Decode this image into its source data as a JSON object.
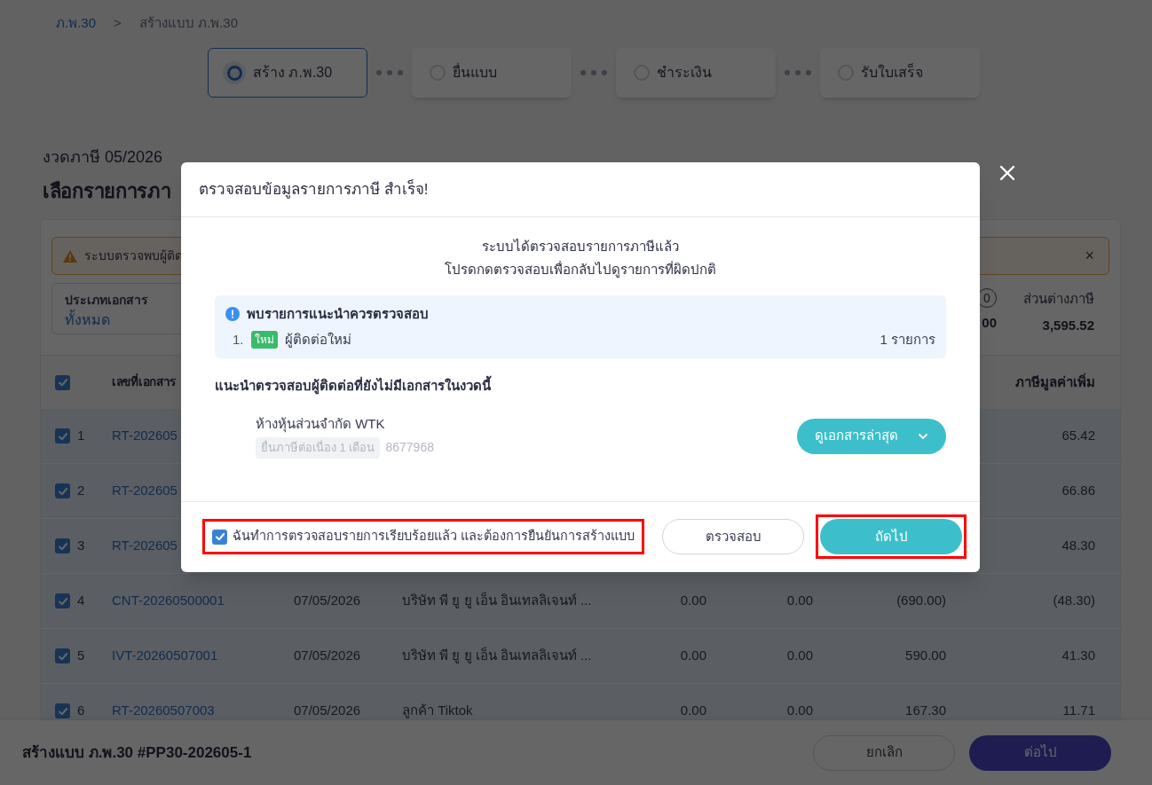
{
  "breadcrumb": [
    {
      "label": "ภ.พ.30",
      "kind": "link"
    },
    {
      "label": ">",
      "kind": "separator"
    },
    {
      "label": "สร้างแบบ ภ.พ.30",
      "kind": "current"
    }
  ],
  "steps": [
    {
      "label": "สร้าง ภ.พ.30",
      "selected": true
    },
    {
      "label": "ยื่นแบบ",
      "selected": false
    },
    {
      "label": "ชำระเงิน",
      "selected": false
    },
    {
      "label": "รับใบเสร็จ",
      "selected": false
    }
  ],
  "period": "งวดภาษี 05/2026",
  "page_title": "เลือกรายการภา",
  "alert": {
    "text": "ระบบตรวจพบผู้ติด",
    "close": "×"
  },
  "filter": {
    "label": "ประเภทเอกสาร",
    "value": "ทั้งหมด"
  },
  "summary_partial": {
    "badge": "0",
    "value": "00"
  },
  "tax_difference": {
    "label": "ส่วนต่างภาษี",
    "value": "3,595.52"
  },
  "table": {
    "header_checked": true,
    "headers": {
      "document_no": "เลขที่เอกสาร",
      "vat": "ภาษีมูลค่าเพิ่ม"
    },
    "rows": [
      {
        "checked": true,
        "index": "1",
        "document_no": "RT-202605",
        "vat": "65.42"
      },
      {
        "checked": true,
        "index": "2",
        "document_no": "RT-202605",
        "vat": "66.86"
      },
      {
        "checked": true,
        "index": "3",
        "document_no": "RT-202605",
        "vat": "48.30"
      },
      {
        "checked": true,
        "index": "4",
        "document_no": "CNT-20260500001",
        "date": "07/05/2026",
        "name": "บริษัท พี ยู ยู เอ็น อินเทลลิเจนท์ ...",
        "column_5": "0.00",
        "column_6": "0.00",
        "column_7": "(690.00)",
        "vat": "(48.30)"
      },
      {
        "checked": true,
        "index": "5",
        "document_no": "IVT-20260507001",
        "date": "07/05/2026",
        "name": "บริษัท พี ยู ยู เอ็น อินเทลลิเจนท์ ...",
        "column_5": "0.00",
        "column_6": "0.00",
        "column_7": "590.00",
        "vat": "41.30"
      },
      {
        "checked": true,
        "index": "6",
        "document_no": "RT-20260507003",
        "date": "07/05/2026",
        "name": "ลูกค้า Tiktok",
        "column_5": "0.00",
        "column_6": "0.00",
        "column_7": "167.30",
        "vat": "11.71"
      }
    ]
  },
  "footer": {
    "title": "สร้างแบบ ภ.พ.30 #PP30-202605-1",
    "buttons": [
      {
        "label": "ยกเลิก",
        "kind": "secondary"
      },
      {
        "label": "ต่อไป",
        "kind": "primary"
      }
    ]
  },
  "dialog": {
    "title": "ตรวจสอบข้อมูลรายการภาษี สำเร็จ!",
    "message": [
      "ระบบได้ตรวจสอบรายการภาษีแล้ว",
      "โปรดกดตรวจสอบเพื่อกลับไปดูรายการที่ผิดปกติ"
    ],
    "notice": {
      "title": "พบรายการแนะนำควรตรวจสอบ",
      "items": [
        {
          "number": "1.",
          "tag": "ใหม่",
          "label": "ผู้ติดต่อใหม่",
          "count": "1 รายการ"
        }
      ]
    },
    "section_title": "แนะนำตรวจสอบผู้ติดต่อที่ยังไม่มีเอกสารในงวดนี้",
    "contacts": [
      {
        "name": "ห้างหุ้นส่วนจำกัด WTK",
        "tag": "ยื่นภาษีต่อเนื่อง 1 เดือน",
        "code": "8677968",
        "action": "ดูเอกสารล่าสุด"
      }
    ],
    "confirm": {
      "label": "ฉันทำการตรวจสอบรายการเรียบร้อยแล้ว และต้องการยืนยันการสร้างแบบ",
      "checked": true,
      "highlighted": true
    },
    "buttons": [
      {
        "label": "ตรวจสอบ",
        "kind": "secondary",
        "highlighted": false
      },
      {
        "label": "ถัดไป",
        "kind": "primary",
        "highlighted": true
      }
    ]
  }
}
